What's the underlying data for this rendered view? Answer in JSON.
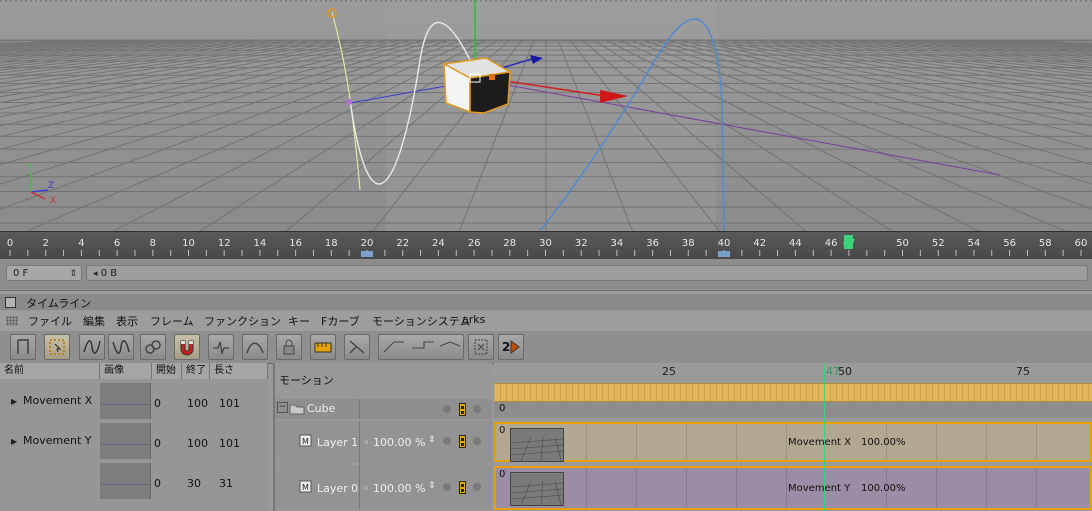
{
  "ruler": {
    "labels": [
      "0",
      "2",
      "4",
      "6",
      "8",
      "10",
      "12",
      "14",
      "16",
      "18",
      "20",
      "22",
      "24",
      "26",
      "28",
      "30",
      "32",
      "34",
      "36",
      "38",
      "40",
      "42",
      "44",
      "46",
      "47",
      "50",
      "52",
      "54",
      "56",
      "58",
      "60"
    ],
    "current_frame": "47"
  },
  "frame_row": {
    "frame_field": "0 F",
    "second_field": "0 B"
  },
  "timeline": {
    "title": "タイムライン",
    "menu": [
      "ファイル",
      "編集",
      "表示",
      "フレーム",
      "ファンクション",
      "キー",
      "Fカーブ",
      "モーションシステム",
      "arks"
    ],
    "toolbar_badge": "2"
  },
  "track_list": {
    "columns": [
      "名前",
      "画像",
      "開始",
      "終了",
      "長さ"
    ],
    "rows": [
      {
        "name": "Movement X",
        "start": "0",
        "end": "100",
        "length": "101"
      },
      {
        "name": "Movement Y",
        "start": "0",
        "end": "100",
        "length": "101"
      },
      {
        "name": "",
        "start": "0",
        "end": "30",
        "length": "31"
      }
    ]
  },
  "motion_panel": {
    "header": "モーション",
    "object": "Cube",
    "layers": [
      {
        "name": "Layer 1",
        "value": "100.00 %"
      },
      {
        "name": "Layer 0",
        "value": "100.00 %"
      }
    ]
  },
  "timeline_area": {
    "ticks": [
      "25",
      "47",
      "50",
      "75"
    ],
    "object_row_value": "0",
    "clips": [
      {
        "start": "0",
        "label": "Movement X",
        "percent": "100.00%",
        "color": "#b2a892"
      },
      {
        "start": "0",
        "label": "Movement Y",
        "percent": "100.00%",
        "color": "#9c8da6"
      }
    ]
  },
  "colors": {
    "accent_orange": "#e8a000",
    "playhead_green": "#3bd37a",
    "viewport_bg": "#8f8f8f"
  }
}
